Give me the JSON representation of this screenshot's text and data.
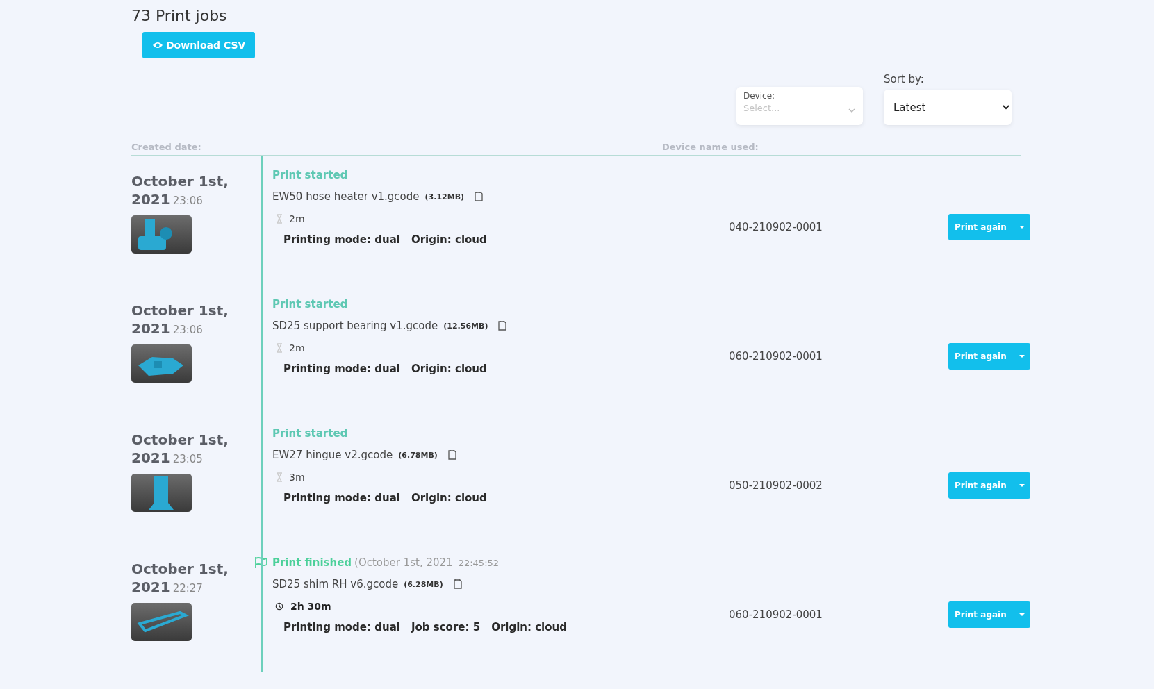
{
  "title": "73 Print jobs",
  "download_button": "Download CSV",
  "device_filter": {
    "label": "Device:",
    "placeholder": "Select..."
  },
  "sort": {
    "label": "Sort by:",
    "value": "Latest"
  },
  "columns": {
    "created_date": "Created date:",
    "device_name": "Device name used:"
  },
  "jobs": [
    {
      "date": "October 1st, 2021",
      "time": "23:06",
      "event": {
        "kind": "started",
        "label": "Print started"
      },
      "file": "EW50 hose heater v1.gcode",
      "size": "(3.12MB)",
      "duration": "2m",
      "details": [
        "Printing mode: dual",
        "Origin: cloud"
      ],
      "device": "040-210902-0001",
      "action": "Print again"
    },
    {
      "date": "October 1st, 2021",
      "time": "23:06",
      "event": {
        "kind": "started",
        "label": "Print started"
      },
      "file": "SD25 support bearing v1.gcode",
      "size": "(12.56MB)",
      "duration": "2m",
      "details": [
        "Printing mode: dual",
        "Origin: cloud"
      ],
      "device": "060-210902-0001",
      "action": "Print again"
    },
    {
      "date": "October 1st, 2021",
      "time": "23:05",
      "event": {
        "kind": "started",
        "label": "Print started"
      },
      "file": "EW27 hingue v2.gcode",
      "size": "(6.78MB)",
      "duration": "3m",
      "details": [
        "Printing mode: dual",
        "Origin: cloud"
      ],
      "device": "050-210902-0002",
      "action": "Print again"
    },
    {
      "date": "October 1st, 2021",
      "time": "22:27",
      "event": {
        "kind": "finished",
        "label": "Print finished",
        "date": "(October 1st, 2021",
        "time": "22:45:52"
      },
      "file": "SD25 shim RH v6.gcode",
      "size": "(6.28MB)",
      "duration": "2h 30m",
      "details": [
        "Printing mode: dual",
        "Job score: 5",
        "Origin: cloud"
      ],
      "device": "060-210902-0001",
      "action": "Print again"
    }
  ]
}
